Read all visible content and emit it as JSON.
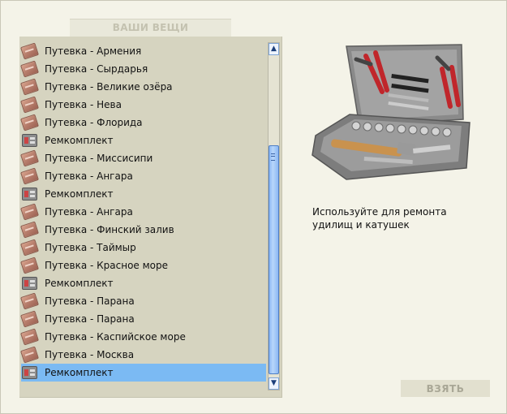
{
  "panel": {
    "title": "ВАШИ ВЕЩИ"
  },
  "items": [
    {
      "label": "Путевка - Армения",
      "icon": "ticket-icon",
      "selected": false
    },
    {
      "label": "Путевка - Сырдарья",
      "icon": "ticket-icon",
      "selected": false
    },
    {
      "label": "Путевка - Великие озёра",
      "icon": "ticket-icon",
      "selected": false
    },
    {
      "label": "Путевка - Нева",
      "icon": "ticket-icon",
      "selected": false
    },
    {
      "label": "Путевка - Флорида",
      "icon": "ticket-icon",
      "selected": false
    },
    {
      "label": "Ремкомплект",
      "icon": "repair-kit-icon",
      "selected": false
    },
    {
      "label": "Путевка - Миссисипи",
      "icon": "ticket-icon",
      "selected": false
    },
    {
      "label": "Путевка - Ангара",
      "icon": "ticket-icon",
      "selected": false
    },
    {
      "label": "Ремкомплект",
      "icon": "repair-kit-icon",
      "selected": false
    },
    {
      "label": "Путевка - Ангара",
      "icon": "ticket-icon",
      "selected": false
    },
    {
      "label": "Путевка - Финский залив",
      "icon": "ticket-icon",
      "selected": false
    },
    {
      "label": "Путевка - Таймыр",
      "icon": "ticket-icon",
      "selected": false
    },
    {
      "label": "Путевка - Красное море",
      "icon": "ticket-icon",
      "selected": false
    },
    {
      "label": "Ремкомплект",
      "icon": "repair-kit-icon",
      "selected": false
    },
    {
      "label": "Путевка - Парана",
      "icon": "ticket-icon",
      "selected": false
    },
    {
      "label": "Путевка - Парана",
      "icon": "ticket-icon",
      "selected": false
    },
    {
      "label": "Путевка - Каспийское море",
      "icon": "ticket-icon",
      "selected": false
    },
    {
      "label": "Путевка - Москва",
      "icon": "ticket-icon",
      "selected": false
    },
    {
      "label": "Ремкомплект",
      "icon": "repair-kit-icon",
      "selected": true
    }
  ],
  "detail": {
    "image_icon": "toolbox-image",
    "description": "Используйте для ремонта удилищ и катушек"
  },
  "actions": {
    "take_label": "ВЗЯТЬ"
  },
  "colors": {
    "selection": "#7bbaf3",
    "panel_bg": "#d6d4c0",
    "page_bg": "#f4f3e8"
  }
}
